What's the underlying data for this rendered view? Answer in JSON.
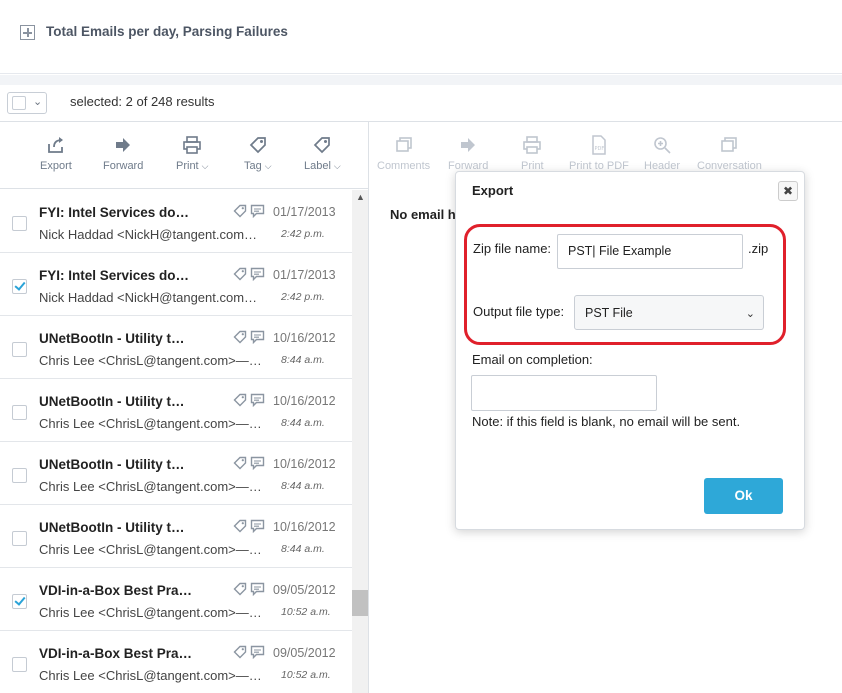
{
  "header": {
    "title": "Total Emails per day, Parsing Failures"
  },
  "selection": {
    "text": "selected: 2 of 248 results"
  },
  "list_toolbar": [
    {
      "label": "Export",
      "icon": "export-icon",
      "dropdown": false
    },
    {
      "label": "Forward",
      "icon": "forward-icon",
      "dropdown": false
    },
    {
      "label": "Print",
      "icon": "print-icon",
      "dropdown": true
    },
    {
      "label": "Tag",
      "icon": "tag-icon",
      "dropdown": true
    },
    {
      "label": "Label",
      "icon": "label-icon",
      "dropdown": true
    }
  ],
  "viewer_toolbar": [
    {
      "label": "Comments",
      "icon": "comments-icon"
    },
    {
      "label": "Forward",
      "icon": "forward-icon"
    },
    {
      "label": "Print",
      "icon": "print-icon"
    },
    {
      "label": "Print to PDF",
      "icon": "pdf-icon"
    },
    {
      "label": "Header",
      "icon": "zoom-icon"
    },
    {
      "label": "Conversation",
      "icon": "conversation-icon"
    }
  ],
  "emails": [
    {
      "subject": "FYI: Intel Services do…",
      "from": "Nick Haddad <NickH@tangent.com…",
      "date": "01/17/2013",
      "time": "2:42 p.m.",
      "checked": false
    },
    {
      "subject": "FYI: Intel Services do…",
      "from": "Nick Haddad <NickH@tangent.com…",
      "date": "01/17/2013",
      "time": "2:42 p.m.",
      "checked": true
    },
    {
      "subject": "UNetBootIn - Utility t…",
      "from": "Chris Lee <ChrisL@tangent.com>—…",
      "date": "10/16/2012",
      "time": "8:44 a.m.",
      "checked": false
    },
    {
      "subject": "UNetBootIn - Utility t…",
      "from": "Chris Lee <ChrisL@tangent.com>—…",
      "date": "10/16/2012",
      "time": "8:44 a.m.",
      "checked": false
    },
    {
      "subject": "UNetBootIn - Utility t…",
      "from": "Chris Lee <ChrisL@tangent.com>—…",
      "date": "10/16/2012",
      "time": "8:44 a.m.",
      "checked": false
    },
    {
      "subject": "UNetBootIn - Utility t…",
      "from": "Chris Lee <ChrisL@tangent.com>—…",
      "date": "10/16/2012",
      "time": "8:44 a.m.",
      "checked": false
    },
    {
      "subject": "VDI-in-a-Box Best Pra…",
      "from": "Chris Lee <ChrisL@tangent.com>—…",
      "date": "09/05/2012",
      "time": "10:52 a.m.",
      "checked": true
    },
    {
      "subject": "VDI-in-a-Box Best Pra…",
      "from": "Chris Lee <ChrisL@tangent.com>—…",
      "date": "09/05/2012",
      "time": "10:52 a.m.",
      "checked": false
    }
  ],
  "viewer": {
    "empty_text": "No email h"
  },
  "export_dialog": {
    "title": "Export",
    "close_label": "✖",
    "zip_label": "Zip file name:",
    "zip_value": "PST| File Example",
    "zip_ext": ".zip",
    "type_label": "Output file type:",
    "type_value": "PST File",
    "email_label": "Email on completion:",
    "email_value": "",
    "note": "Note: if this field is blank, no email will be sent.",
    "ok_label": "Ok"
  },
  "colors": {
    "accent": "#2ea8d8",
    "highlight": "#e0202b",
    "check": "#2aa3d8"
  }
}
